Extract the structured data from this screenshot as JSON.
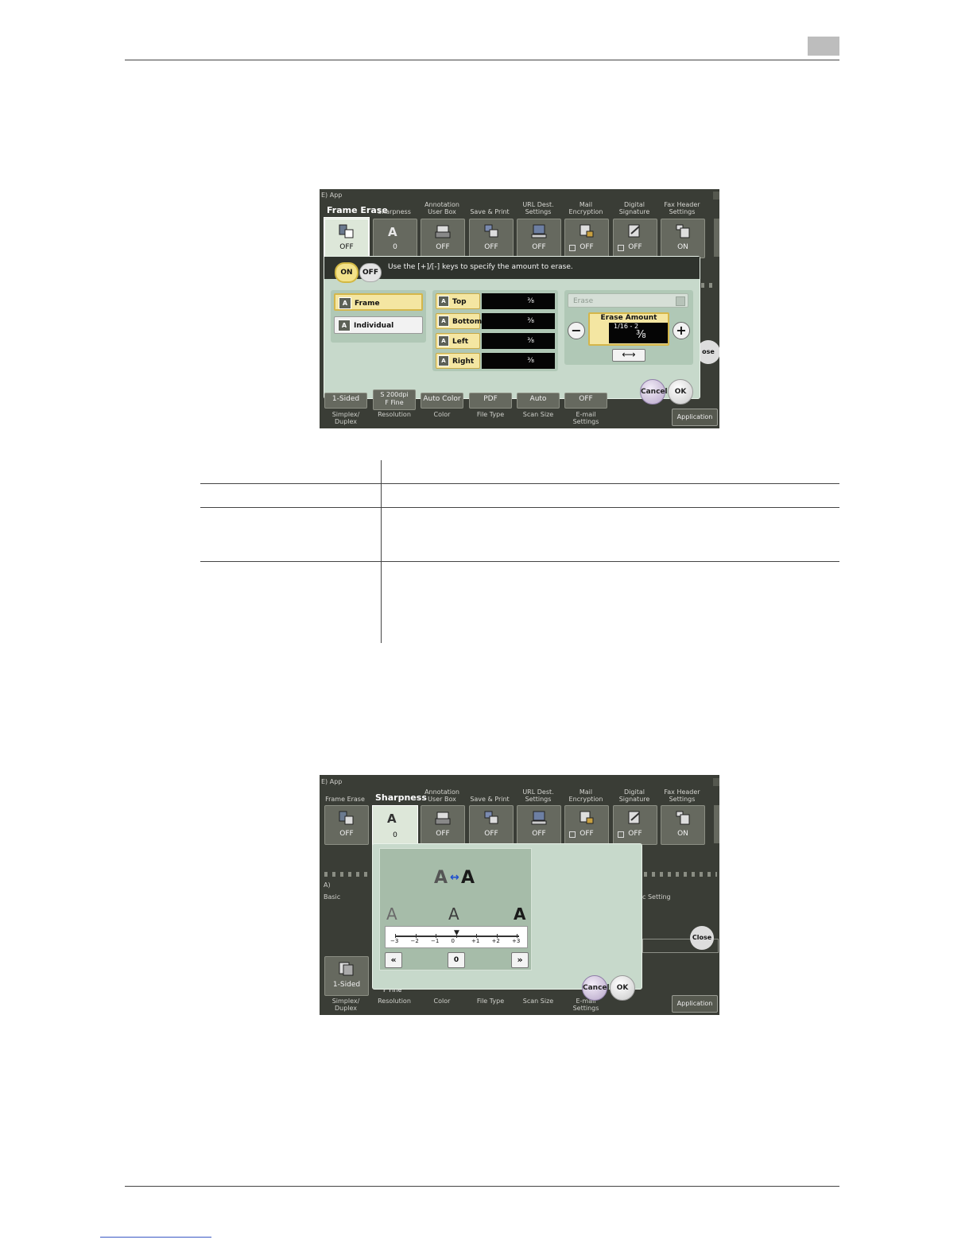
{
  "page": {
    "screen1": {
      "app_tab": "E)  App",
      "active_title": "Frame Erase",
      "top_tabs": [
        {
          "label": "",
          "value": "OFF",
          "icon": "frame-erase-icon"
        },
        {
          "label": "Sharpness",
          "value": "0",
          "icon": "sharpness-icon"
        },
        {
          "label": "Annotation\nUser Box",
          "value": "OFF",
          "icon": "annotation-icon"
        },
        {
          "label": "Save & Print",
          "value": "OFF",
          "icon": "save-print-icon"
        },
        {
          "label": "URL Dest.\nSettings",
          "value": "OFF",
          "icon": "url-dest-icon"
        },
        {
          "label": "Mail\nEncryption",
          "value": "OFF",
          "icon": "mail-encryption-icon"
        },
        {
          "label": "Digital\nSignature",
          "value": "OFF",
          "icon": "digital-signature-icon"
        },
        {
          "label": "Fax Header\nSettings",
          "value": "ON",
          "icon": "fax-header-icon"
        }
      ],
      "on_label": "ON",
      "off_label": "OFF",
      "message": "Use the [+]/[-] keys to specify the amount to erase.",
      "options": [
        {
          "label": "Frame",
          "selected": true
        },
        {
          "label": "Individual",
          "selected": false
        }
      ],
      "sides": [
        {
          "label": "Top",
          "value": "⅜"
        },
        {
          "label": "Bottom",
          "value": "⅜"
        },
        {
          "label": "Left",
          "value": "⅜"
        },
        {
          "label": "Right",
          "value": "⅜"
        }
      ],
      "erase_select": "Erase",
      "erase_amount_title": "Erase Amount",
      "erase_amount_range": "1/16 - 2",
      "erase_amount_value": "⅜",
      "swap_arrow": "⟷",
      "close_label": "ose",
      "bottom_tabs": [
        {
          "value": "1-Sided",
          "label": "Simplex/\nDuplex"
        },
        {
          "value": "S 200dpi\nF Fine",
          "label": "Resolution"
        },
        {
          "value": "Auto Color",
          "label": "Color"
        },
        {
          "value": "PDF",
          "label": "File Type"
        },
        {
          "value": "Auto",
          "label": "Scan Size"
        },
        {
          "value": "OFF",
          "label": "E-mail\nSettings"
        }
      ],
      "cancel_label": "Cancel",
      "ok_label": "OK",
      "application_label": "Application"
    },
    "screen2": {
      "app_tab": "E)  App",
      "top_tabs": [
        {
          "label": "Frame Erase",
          "value": "OFF",
          "icon": "frame-erase-icon"
        },
        {
          "label": "Sharpness",
          "value": "0",
          "icon": "sharpness-icon"
        },
        {
          "label": "Annotation\nUser Box",
          "value": "OFF",
          "icon": "annotation-icon"
        },
        {
          "label": "Save & Print",
          "value": "OFF",
          "icon": "save-print-icon"
        },
        {
          "label": "URL Dest.\nSettings",
          "value": "OFF",
          "icon": "url-dest-icon"
        },
        {
          "label": "Mail\nEncryption",
          "value": "OFF",
          "icon": "mail-encryption-icon"
        },
        {
          "label": "Digital\nSignature",
          "value": "OFF",
          "icon": "digital-signature-icon"
        },
        {
          "label": "Fax Header\nSettings",
          "value": "ON",
          "icon": "fax-header-icon"
        }
      ],
      "preview_glyph": "A",
      "preview_arrow": "↔",
      "sample_glyph": "A",
      "scale_ticks": [
        "−3",
        "−2",
        "−1",
        "0",
        "+1",
        "+2",
        "+3"
      ],
      "scale_value": 0,
      "left_btn": "«",
      "right_btn": "»",
      "value_btn": "0",
      "left_texts": {
        "a": "A)",
        "basic": "Basic"
      },
      "right_text": "c Setting",
      "close_label": "Close",
      "bottom_tile": "1-Sided",
      "bottom_labels": [
        "Simplex/\nDuplex",
        "Resolution",
        "Color",
        "File Type",
        "Scan Size",
        "E-mail\nSettings"
      ],
      "resolution_partial": "F Fine",
      "cancel_label": "Cancel",
      "ok_label": "OK",
      "application_label": "Application"
    }
  }
}
